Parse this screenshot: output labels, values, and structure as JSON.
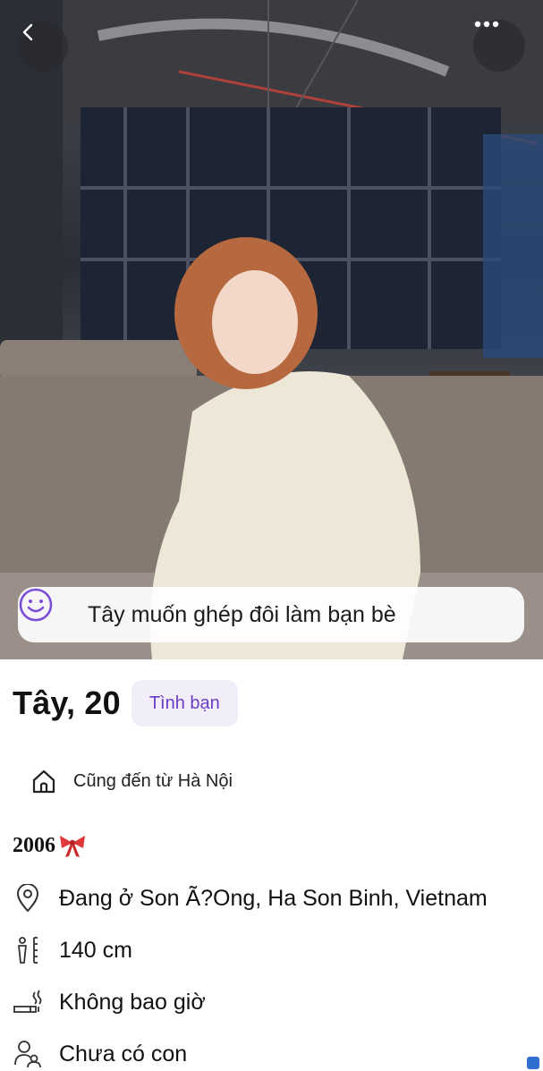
{
  "header": {
    "back_icon": "chevron-left-icon",
    "more_icon": "more-horizontal-icon"
  },
  "match_banner": {
    "icon": "smile-face-icon",
    "text": "Tây muốn ghép đôi làm bạn bè",
    "icon_color": "#7b4fd6"
  },
  "profile": {
    "name_age": "Tây, 20",
    "tag": "Tình bạn",
    "tag_color": "#6a3cc7",
    "hometown": "Cũng đến từ Hà Nội",
    "bio": "2006",
    "bio_emoji": "ribbon-bow"
  },
  "details": [
    {
      "icon": "location-pin-icon",
      "text": "Đang ở Son Ã?Ong, Ha Son Binh, Vietnam"
    },
    {
      "icon": "height-ruler-icon",
      "text": "140 cm"
    },
    {
      "icon": "smoking-icon",
      "text": "Không bao giờ"
    },
    {
      "icon": "children-icon",
      "text": "Chưa có con"
    }
  ]
}
